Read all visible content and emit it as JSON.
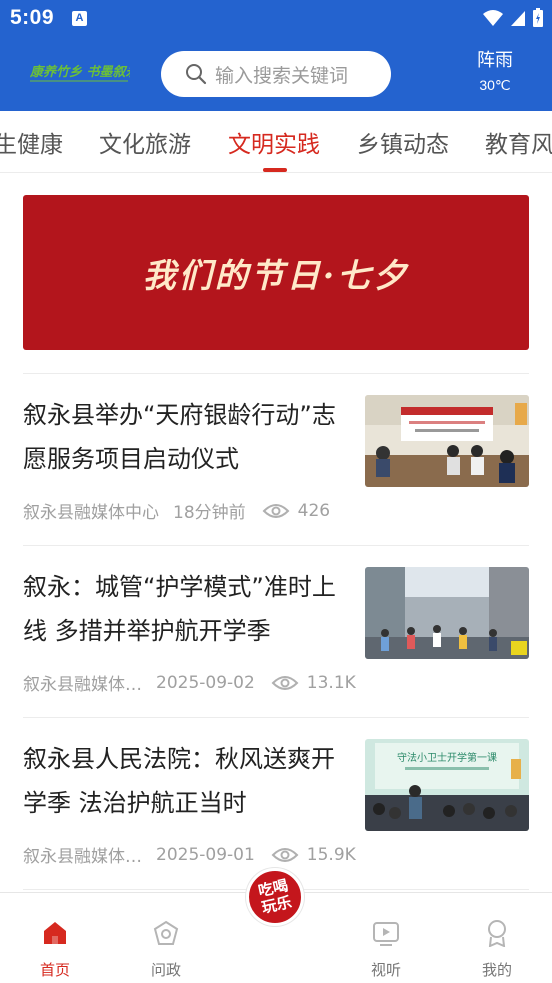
{
  "status_bar": {
    "time": "5:09",
    "indicator": "A"
  },
  "header": {
    "logo_text": "康养竹乡 书墨叙永",
    "search_placeholder": "输入搜索关键词",
    "weather_condition": "阵雨",
    "weather_temp": "30℃"
  },
  "tabs": [
    {
      "label": "生健康"
    },
    {
      "label": "文化旅游"
    },
    {
      "label": "文明实践",
      "active": true
    },
    {
      "label": "乡镇动态"
    },
    {
      "label": "教育风"
    }
  ],
  "banner": {
    "text": "我们的节日·七夕"
  },
  "news": [
    {
      "title": "叙永县举办“天府银龄行动”志愿服务项目启动仪式",
      "source": "叙永县融媒体中心",
      "time": "18分钟前",
      "views": "426"
    },
    {
      "title": "叙永：城管“护学模式”准时上线  多措并举护航开学季",
      "source": "叙永县融媒体…",
      "time": "2025-09-02",
      "views": "13.1K"
    },
    {
      "title": "叙永县人民法院：秋风送爽开学季  法治护航正当时",
      "source": "叙永县融媒体…",
      "time": "2025-09-01",
      "views": "15.9K",
      "thumb_caption": "守法小卫士开学第一课"
    }
  ],
  "bottom_nav": [
    {
      "label": "首页",
      "icon": "home-icon",
      "active": true
    },
    {
      "label": "问政",
      "icon": "inquiry-icon"
    },
    {
      "label": "视听",
      "icon": "tv-icon"
    },
    {
      "label": "我的",
      "icon": "profile-icon"
    }
  ],
  "center_badge": {
    "text": "吃喝玩乐"
  },
  "colors": {
    "primary_blue": "#2463cf",
    "accent_red": "#d6291f",
    "banner_red": "#b3151c"
  }
}
